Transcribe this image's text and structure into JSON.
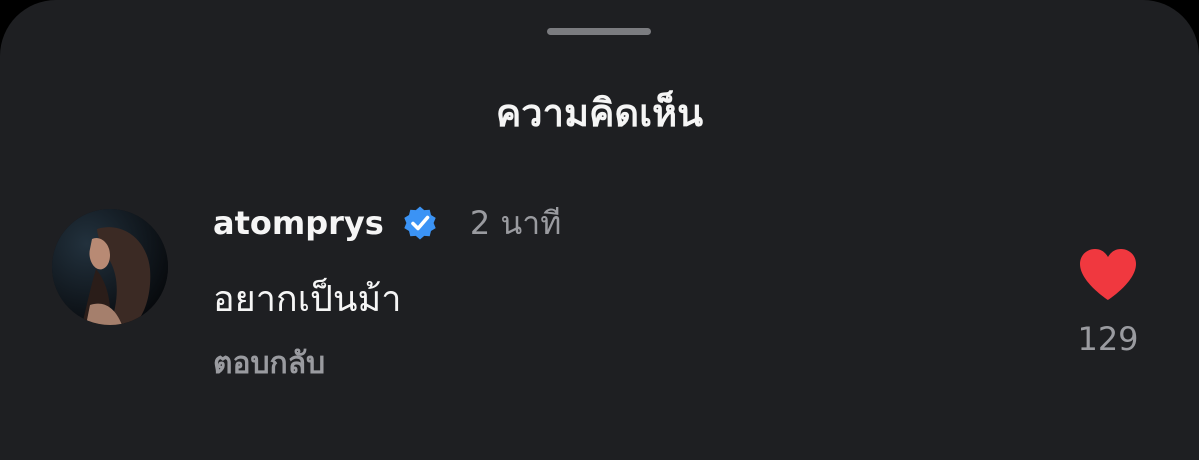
{
  "sheet": {
    "title": "ความคิดเห็น"
  },
  "comment": {
    "username": "atomprys",
    "verified": true,
    "time": "2 นาที",
    "text": "อยากเป็นม้า",
    "reply_label": "ตอบกลับ",
    "likes": "129",
    "liked": true
  },
  "colors": {
    "background": "#1e1f22",
    "heart": "#f0383f",
    "verified_badge": "#3b93f5",
    "muted_text": "#9a9ba0"
  },
  "icons": {
    "verified": "verified-badge-icon",
    "like": "heart-icon"
  }
}
